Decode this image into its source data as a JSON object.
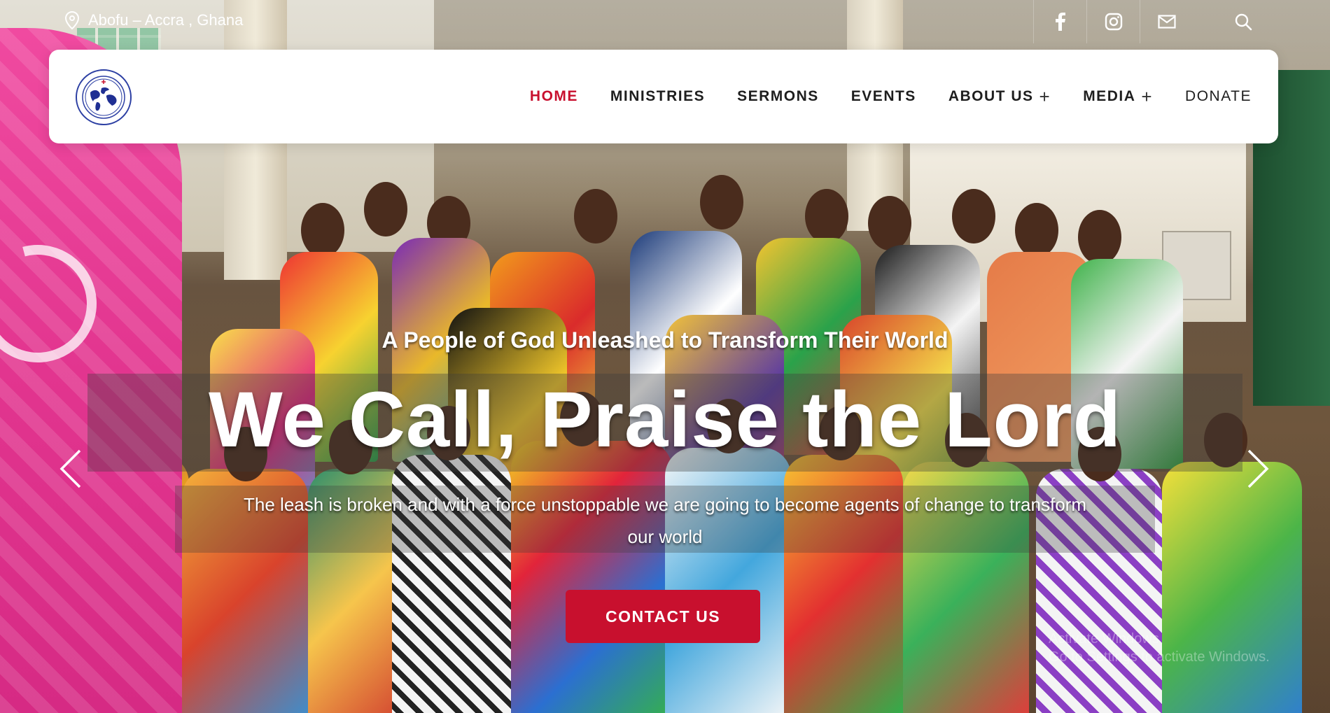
{
  "topbar": {
    "location": "Abofu – Accra , Ghana",
    "social_icons": [
      "facebook-icon",
      "instagram-icon",
      "mail-icon",
      "search-icon"
    ]
  },
  "nav": {
    "items": [
      {
        "label": "HOME",
        "active": true
      },
      {
        "label": "MINISTRIES"
      },
      {
        "label": "SERMONS"
      },
      {
        "label": "EVENTS"
      },
      {
        "label": "ABOUT US",
        "has_submenu": true
      },
      {
        "label": "MEDIA",
        "has_submenu": true
      },
      {
        "label": "DONATE"
      }
    ],
    "submenu_icon": "+"
  },
  "hero": {
    "tagline": "A People of God Unleashed to Transform Their World",
    "headline": "We Call, Praise the Lord",
    "subtext": "The leash is broken and with a force unstoppable we are going to become agents of change to transform our world",
    "cta_label": "CONTACT US"
  },
  "watermark": {
    "line1": "Activate Windows",
    "line2": "Go to Settings to activate Windows."
  },
  "colors": {
    "accent": "#c8102e",
    "nav_text": "#1e1e1e",
    "banner_pink": "#e2358f",
    "logo_blue": "#2c3fa3"
  }
}
